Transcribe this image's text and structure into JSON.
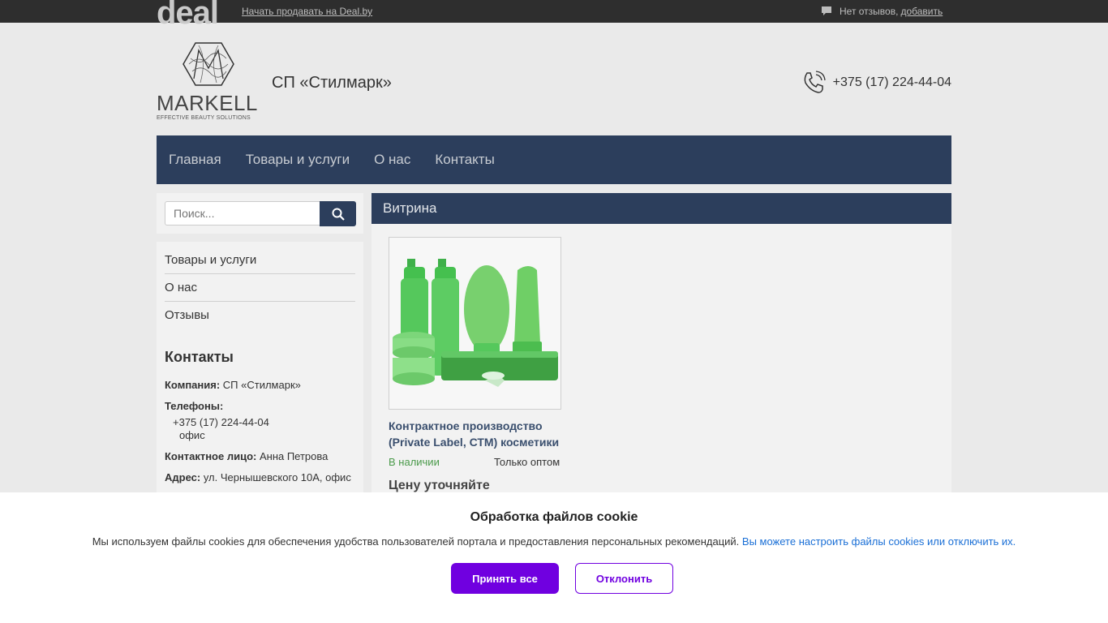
{
  "topbar": {
    "logo_text": "deal",
    "sell_link": "Начать продавать на Deal.by",
    "reviews_text": "Нет отзывов,",
    "reviews_add": "добавить"
  },
  "header": {
    "brand": "MARKELL",
    "brand_tagline": "EFFECTIVE BEAUTY SOLUTIONS",
    "company_name": "СП «Стилмарк»",
    "phone": "+375 (17) 224-44-04"
  },
  "nav": {
    "items": [
      "Главная",
      "Товары и услуги",
      "О нас",
      "Контакты"
    ]
  },
  "search": {
    "placeholder": "Поиск..."
  },
  "sidebar": {
    "items": [
      "Товары и услуги",
      "О нас",
      "Отзывы"
    ],
    "contacts_title": "Контакты",
    "company_label": "Компания:",
    "company_value": "СП «Стилмарк»",
    "phones_label": "Телефоны:",
    "phone_value": "+375 (17) 224-44-04",
    "phone_type": "офис",
    "person_label": "Контактное лицо:",
    "person_value": "Анна Петрова",
    "address_label": "Адрес:",
    "address_value": "ул. Чернышевского 10А, офис"
  },
  "main": {
    "heading": "Витрина",
    "product": {
      "title": "Контрактное производство (Private Label, СТМ) косметики",
      "stock": "В наличии",
      "wholesale": "Только оптом",
      "price": "Цену уточняйте"
    }
  },
  "cookie": {
    "title": "Обработка файлов cookie",
    "text": "Мы используем файлы cookies для обеспечения удобства пользователей портала и предоставления персональных рекомендаций.",
    "link": "Вы можете настроить файлы cookies или отключить их.",
    "accept": "Принять все",
    "decline": "Отклонить"
  },
  "colors": {
    "nav_bg": "#2c3e5c",
    "accent": "#7000e0",
    "in_stock": "#4a9a4a"
  }
}
